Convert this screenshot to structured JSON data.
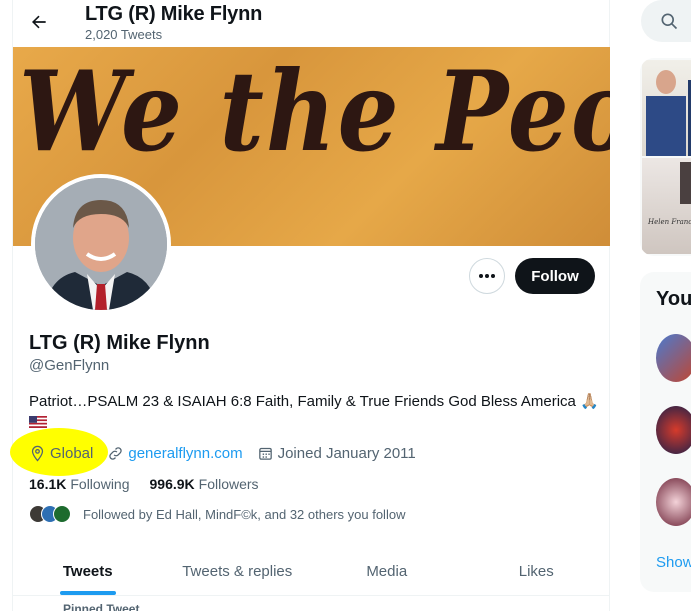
{
  "header": {
    "name": "LTG (R) Mike Flynn",
    "tweet_count": "2,020 Tweets"
  },
  "banner": {
    "text": "We the People"
  },
  "actions": {
    "follow_label": "Follow"
  },
  "profile": {
    "name": "LTG (R) Mike Flynn",
    "handle": "@GenFlynn",
    "bio": "Patriot…PSALM 23 & ISAIAH 6:8 Faith, Family & True Friends  God Bless America 🙏🏼",
    "location": "Global",
    "website": "generalflynn.com",
    "joined": "Joined January 2011",
    "following_count": "16.1K",
    "following_label": "Following",
    "followers_count": "996.9K",
    "followers_label": "Followers",
    "followed_by": "Followed by Ed Hall, MindF©k, and 32 others you follow"
  },
  "tabs": [
    "Tweets",
    "Tweets & replies",
    "Media",
    "Likes"
  ],
  "pinned_label": "Pinned Tweet",
  "sidebar": {
    "media_caption": "Helen Frances",
    "who_to_follow_title": "You",
    "show_more": "Show"
  },
  "colors": {
    "accent": "#1d9bf0",
    "highlight": "#ffff00",
    "follow_button": "#0f1419"
  }
}
